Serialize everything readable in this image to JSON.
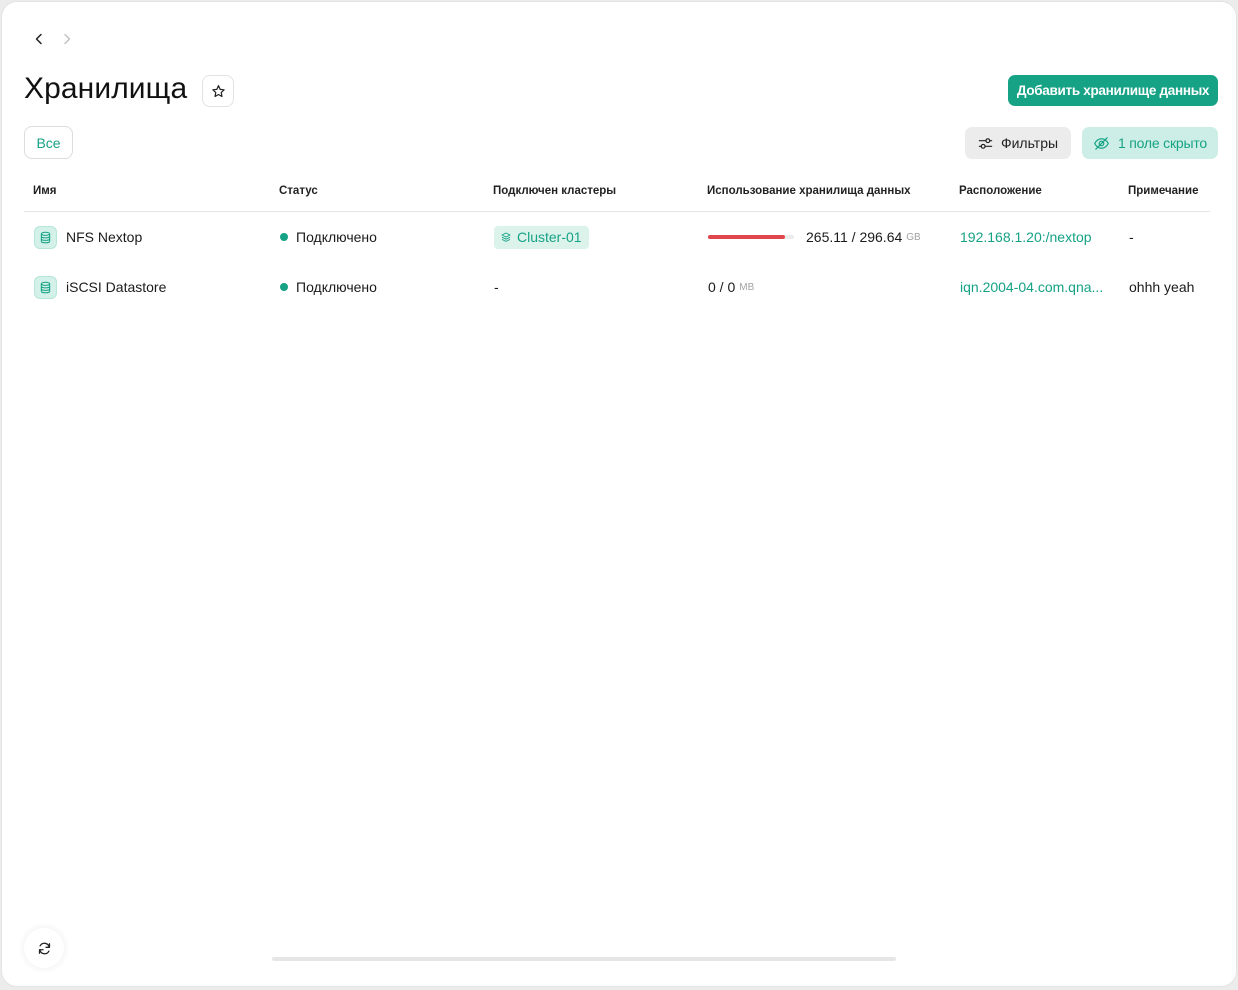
{
  "header": {
    "title": "Хранилища",
    "add_button": "Добавить хранилище данных"
  },
  "toolbar": {
    "all_chip": "Все",
    "filters_label": "Фильтры",
    "hidden_label": "1 поле скрыто"
  },
  "colors": {
    "accent": "#16a285",
    "usage_bar": "#e0464b",
    "status_connected": "#16a285"
  },
  "table": {
    "columns": [
      "Имя",
      "Статус",
      "Подключен кластеры",
      "Использование хранилища данных",
      "Расположение",
      "Примечание"
    ],
    "rows": [
      {
        "name": "NFS Nextop",
        "icon": "database-icon",
        "status": "Подключено",
        "cluster": "Cluster-01",
        "usage_text": "265.11 / 296.64",
        "usage_unit": "GB",
        "usage_fraction": 0.894,
        "location": "192.168.1.20:/nextop",
        "note": "-"
      },
      {
        "name": "iSCSI Datastore",
        "icon": "database-icon",
        "status": "Подключено",
        "cluster": "-",
        "usage_text": "0 / 0",
        "usage_unit": "MB",
        "usage_fraction": 0,
        "location": "iqn.2004-04.com.qna...",
        "note": "ohhh yeah"
      }
    ]
  }
}
